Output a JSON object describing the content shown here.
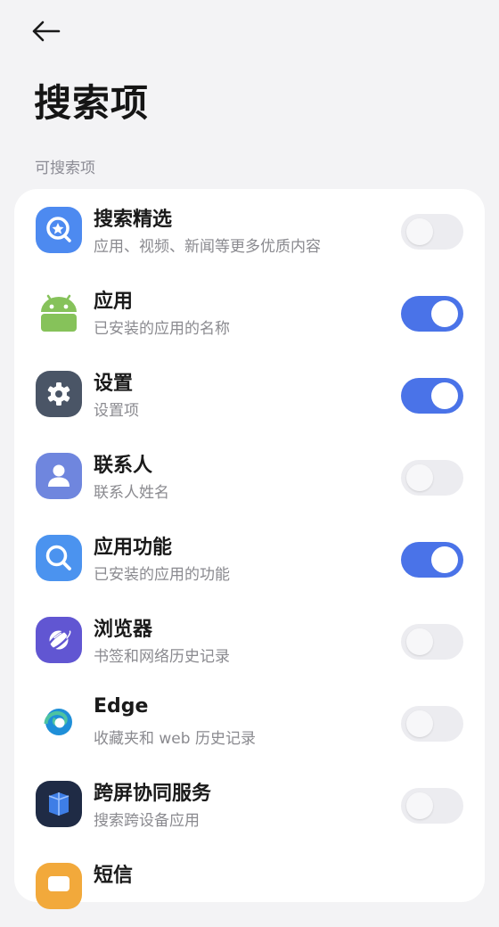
{
  "header": {
    "back_icon": "arrow-left-icon",
    "title": "搜索项"
  },
  "section_label": "可搜索项",
  "colors": {
    "toggle_on": "#4a73e8",
    "toggle_off": "#ececf0",
    "background": "#f3f3f5"
  },
  "items": [
    {
      "title": "搜索精选",
      "subtitle": "应用、视频、新闻等更多优质内容",
      "icon": "search-star-icon",
      "enabled": false
    },
    {
      "title": "应用",
      "subtitle": "已安装的应用的名称",
      "icon": "android-icon",
      "enabled": true
    },
    {
      "title": "设置",
      "subtitle": "设置项",
      "icon": "gear-icon",
      "enabled": true
    },
    {
      "title": "联系人",
      "subtitle": "联系人姓名",
      "icon": "contact-person-icon",
      "enabled": false
    },
    {
      "title": "应用功能",
      "subtitle": "已安装的应用的功能",
      "icon": "magnifier-icon",
      "enabled": true
    },
    {
      "title": "浏览器",
      "subtitle": "书签和网络历史记录",
      "icon": "browser-planet-icon",
      "enabled": false
    },
    {
      "title": "Edge",
      "subtitle": "收藏夹和 web 历史记录",
      "icon": "edge-browser-icon",
      "enabled": false
    },
    {
      "title": "跨屏协同服务",
      "subtitle": "搜索跨设备应用",
      "icon": "cross-screen-icon",
      "enabled": false
    },
    {
      "title": "短信",
      "subtitle": "",
      "icon": "message-icon",
      "hint": ""
    }
  ]
}
